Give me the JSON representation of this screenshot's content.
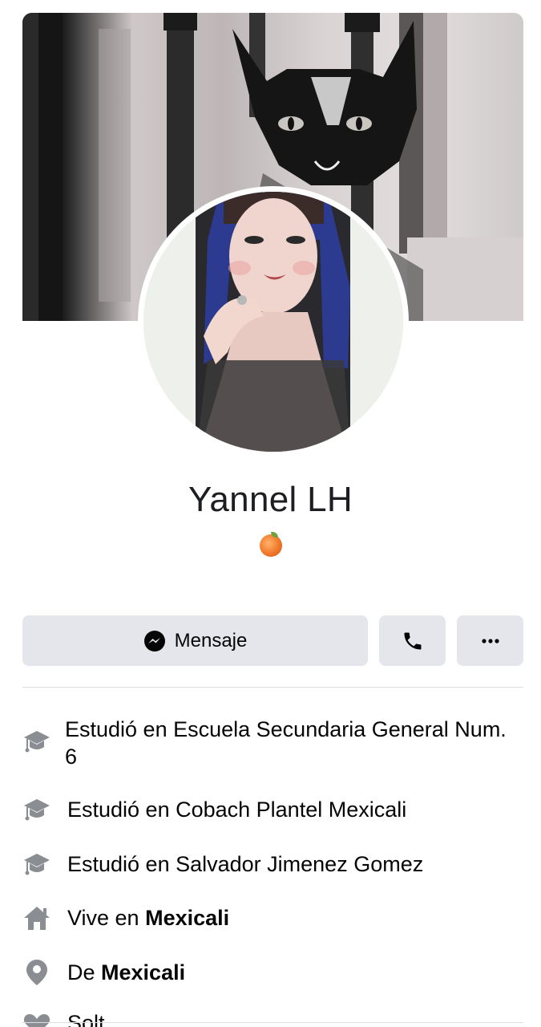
{
  "profile": {
    "name": "Yannel LH",
    "bio_left": "",
    "bio_right": ""
  },
  "actions": {
    "message_label": "Mensaje"
  },
  "intro": {
    "items": [
      {
        "icon": "graduation-cap-icon",
        "text": "Estudió en Escuela Secundaria General Num. 6"
      },
      {
        "icon": "graduation-cap-icon",
        "text": "Estudió en Cobach Plantel Mexicali"
      },
      {
        "icon": "graduation-cap-icon",
        "text": "Estudió en Salvador Jimenez Gomez"
      },
      {
        "icon": "home-icon",
        "prefix": "Vive en ",
        "bold": "Mexicali"
      },
      {
        "icon": "location-pin-icon",
        "prefix": "De ",
        "bold": "Mexicali"
      },
      {
        "icon": "heart-icon",
        "text": "Solt..."
      }
    ]
  },
  "colors": {
    "button_bg": "#e4e6eb",
    "icon_gray": "#8a8d91",
    "text": "#050505"
  }
}
